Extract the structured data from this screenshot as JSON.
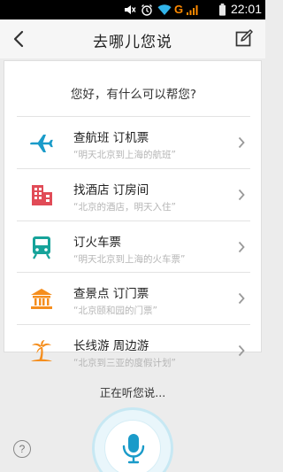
{
  "status_bar": {
    "time": "22:01",
    "network": "G",
    "icons": [
      "mute-icon",
      "alarm-icon",
      "wifi-icon",
      "signal-icon",
      "battery-icon"
    ]
  },
  "header": {
    "title": "去哪儿您说",
    "back_icon": "chevron-left-icon",
    "edit_icon": "edit-icon"
  },
  "card": {
    "greeting": "您好，有什么可以帮您?",
    "items": [
      {
        "icon": "airplane-icon",
        "title": "查航班 订机票",
        "example": "“明天北京到上海的航班”"
      },
      {
        "icon": "hotel-icon",
        "title": "找酒店 订房间",
        "example": "“北京的酒店，明天入住”"
      },
      {
        "icon": "train-icon",
        "title": "订火车票",
        "example": "“明天北京到上海的火车票”"
      },
      {
        "icon": "temple-icon",
        "title": "查景点 订门票",
        "example": "“北京颐和园的门票”"
      },
      {
        "icon": "palm-tree-icon",
        "title": "长线游 周边游",
        "example": "“北京到三亚的度假计划”"
      }
    ]
  },
  "bottom": {
    "listening": "正在听您说...",
    "help": "?"
  },
  "colors": {
    "accent": "#1a9bc9",
    "hotel": "#e14b57",
    "train": "#16a39a",
    "orange": "#f58e1d"
  }
}
